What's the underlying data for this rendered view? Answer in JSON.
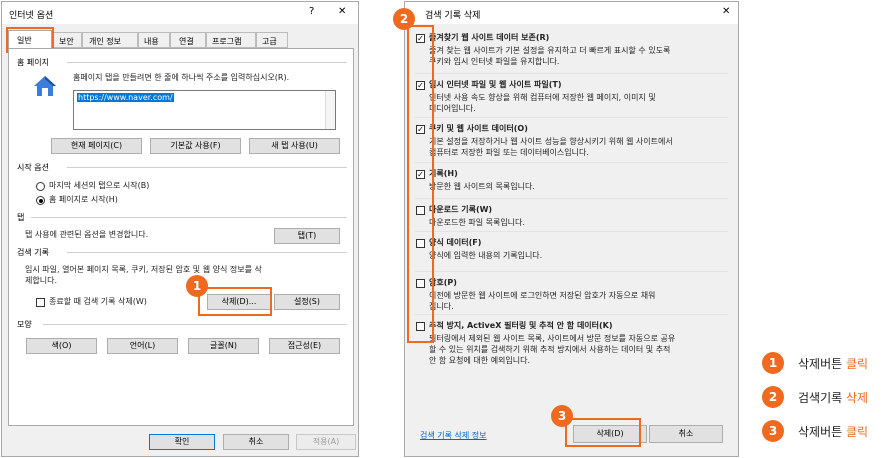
{
  "left": {
    "title": "인터넷 옵션",
    "help": "?",
    "close": "✕",
    "tabs": [
      "일반",
      "보안",
      "개인 정보",
      "내용",
      "연결",
      "프로그램",
      "고급"
    ],
    "home": {
      "section": "홈 페이지",
      "desc": "홈페이지 탭을 만들려면 한 줄에 하나씩 주소를 입력하십시오(R).",
      "url": "https://www.naver.com/",
      "btn_current": "현재 페이지(C)",
      "btn_default": "기본값 사용(F)",
      "btn_newtab": "새 탭 사용(U)"
    },
    "startup": {
      "section": "시작 옵션",
      "opt1": "마지막 세션의 탭으로 시작(B)",
      "opt2": "홈 페이지로 시작(H)"
    },
    "tabsec": {
      "section": "탭",
      "desc": "탭 사용에 관련된 옵션을 변경합니다.",
      "btn": "탭(T)"
    },
    "history": {
      "section": "검색 기록",
      "desc1": "임시 파일, 열어본 페이지 목록, 쿠키, 저장된 암호 및 웹 양식 정보를 삭",
      "desc2": "제합니다.",
      "chk": "종료할 때 검색 기록 삭제(W)",
      "btn_delete": "삭제(D)...",
      "btn_settings": "설정(S)"
    },
    "appearance": {
      "section": "모양",
      "btn_color": "색(O)",
      "btn_lang": "언어(L)",
      "btn_font": "글꼴(N)",
      "btn_access": "접근성(E)"
    },
    "footer": {
      "ok": "확인",
      "cancel": "취소",
      "apply": "적용(A)"
    }
  },
  "right": {
    "title": "검색 기록 삭제",
    "close": "✕",
    "items": [
      {
        "label": "즐겨찾기 웹 사이트 데이터 보존(R)",
        "desc": [
          "즐겨 찾는 웹 사이트가 기본 설정을 유지하고 더 빠르게 표시할 수 있도록",
          "쿠키와 임시 인터넷 파일을 유지합니다."
        ],
        "checked": true
      },
      {
        "label": "임시 인터넷 파일 및 웹 사이트 파일(T)",
        "desc": [
          "인터넷 사용 속도 향상을 위해 컴퓨터에 저장한 웹 페이지, 이미지 및",
          "미디어입니다."
        ],
        "checked": true
      },
      {
        "label": "쿠키 및 웹 사이트 데이터(O)",
        "desc": [
          "기본 설정을 저장하거나 웹 사이트 성능을 향상시키기 위해 웹 사이트에서",
          "컴퓨터로 저장한 파일 또는 데이터베이스입니다."
        ],
        "checked": true
      },
      {
        "label": "기록(H)",
        "desc": [
          "방문한 웹 사이트의 목록입니다."
        ],
        "checked": true
      },
      {
        "label": "다운로드 기록(W)",
        "desc": [
          "다운로드한 파일 목록입니다."
        ],
        "checked": false
      },
      {
        "label": "양식 데이터(F)",
        "desc": [
          "양식에 입력한 내용의 기록입니다."
        ],
        "checked": false
      },
      {
        "label": "암호(P)",
        "desc": [
          "이전에 방문한 웹 사이트에 로그인하면 저장된 암호가 자동으로 채워",
          "집니다."
        ],
        "checked": false
      },
      {
        "label": "추적 방지, ActiveX 필터링 및 추적 안 함 데이터(K)",
        "desc": [
          "필터링에서 제외된 웹 사이트 목록, 사이트에서 방문 정보를 자동으로 공유",
          "할 수 있는 위치를 검색하기 위해 추적 방지에서 사용하는 데이터 및 추적",
          "안 함 요청에 대한 예외입니다."
        ],
        "checked": false
      }
    ],
    "link": "검색 기록 삭제 정보",
    "btn_delete": "삭제(D)",
    "btn_cancel": "취소"
  },
  "badges": [
    "1",
    "2",
    "3"
  ],
  "legend": [
    {
      "num": "1",
      "text": "삭제버튼 ",
      "accent": "클릭"
    },
    {
      "num": "2",
      "text": "검색기록 ",
      "accent": "삭제"
    },
    {
      "num": "3",
      "text": "삭제버튼 ",
      "accent": "클릭"
    }
  ],
  "colors": {
    "accent": "#ef6a1f",
    "link": "#0066cc",
    "selection": "#0078d7"
  }
}
